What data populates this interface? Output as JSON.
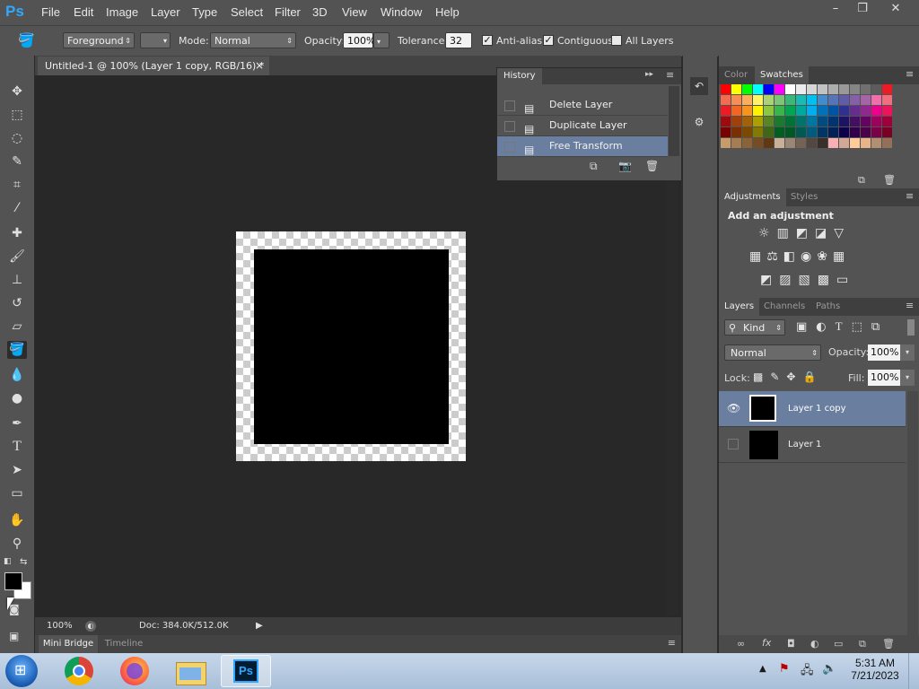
{
  "app": {
    "logo": "Ps"
  },
  "menu": [
    "File",
    "Edit",
    "Image",
    "Layer",
    "Type",
    "Select",
    "Filter",
    "3D",
    "View",
    "Window",
    "Help"
  ],
  "window_controls": {
    "minimize": "–",
    "restore": "❐",
    "close": "✕"
  },
  "options": {
    "fill_source": "Foreground",
    "mode_label": "Mode:",
    "mode_value": "Normal",
    "opacity_label": "Opacity:",
    "opacity_value": "100%",
    "tolerance_label": "Tolerance:",
    "tolerance_value": "32",
    "antialias_label": "Anti-alias",
    "antialias_checked": true,
    "contiguous_label": "Contiguous",
    "contiguous_checked": true,
    "alllayers_label": "All Layers",
    "alllayers_checked": false
  },
  "document": {
    "tab_title": "Untitled-1 @ 100% (Layer 1 copy, RGB/16) *",
    "close_glyph": "×",
    "zoom": "100%",
    "doc_info": "Doc: 384.0K/512.0K"
  },
  "bottom_tabs": [
    "Mini Bridge",
    "Timeline"
  ],
  "history": {
    "title": "History",
    "items": [
      {
        "label": "Delete Layer",
        "selected": false
      },
      {
        "label": "Duplicate Layer",
        "selected": false
      },
      {
        "label": "Free Transform",
        "selected": true
      }
    ]
  },
  "swatches_panel": {
    "tabs": [
      "Color",
      "Swatches"
    ],
    "active": "Swatches",
    "colors": [
      "#ff0000",
      "#ffff00",
      "#00ff00",
      "#00ffff",
      "#0000ff",
      "#ff00ff",
      "#ffffff",
      "#ebebeb",
      "#d6d6d6",
      "#c2c2c2",
      "#adadad",
      "#999999",
      "#858585",
      "#707070",
      "#5c5c5c",
      "#ed1c24",
      "#f26c4f",
      "#f68e55",
      "#fbaf5c",
      "#fff467",
      "#acd372",
      "#7cc576",
      "#3bb878",
      "#1abbb4",
      "#00bff3",
      "#438ccb",
      "#5574b9",
      "#605ca8",
      "#855fa8",
      "#a763a8",
      "#f06ea9",
      "#f26d7d",
      "#ed1c24",
      "#f26522",
      "#f7941d",
      "#fff200",
      "#8dc63f",
      "#39b54a",
      "#00a651",
      "#00a99d",
      "#00aeef",
      "#0072bc",
      "#0054a6",
      "#2e3192",
      "#662d91",
      "#92278f",
      "#ec008c",
      "#ed145b",
      "#9e0b0f",
      "#a0410d",
      "#a36209",
      "#aba000",
      "#598527",
      "#1a7b30",
      "#007236",
      "#00746b",
      "#0076a3",
      "#004b80",
      "#003471",
      "#1b1464",
      "#440e62",
      "#630460",
      "#9e005d",
      "#9e0039",
      "#790000",
      "#7b2e00",
      "#7d4900",
      "#827b00",
      "#406618",
      "#005e20",
      "#005826",
      "#005952",
      "#005b7f",
      "#003663",
      "#002157",
      "#0d004c",
      "#32004b",
      "#4b0049",
      "#7b0046",
      "#7a0026",
      "#c69c6d",
      "#a67c52",
      "#8c6239",
      "#754c24",
      "#603913",
      "#c7b299",
      "#998675",
      "#736357",
      "#534741",
      "#37302a",
      "#f9aeb4",
      "#d2a897",
      "#ffcc99",
      "#e8b48a",
      "#b09070",
      "#957059"
    ]
  },
  "adjustments_panel": {
    "tabs": [
      "Adjustments",
      "Styles"
    ],
    "active": "Adjustments",
    "heading": "Add an adjustment",
    "icons_row1": [
      "brightness-icon",
      "levels-icon",
      "curves-icon",
      "exposure-icon",
      "vibrance-icon"
    ],
    "icons_row2": [
      "hue-saturation-icon",
      "color-balance-icon",
      "black-white-icon",
      "photo-filter-icon",
      "channel-mixer-icon",
      "color-lookup-icon"
    ],
    "icons_row3": [
      "invert-icon",
      "posterize-icon",
      "threshold-icon",
      "selective-color-icon",
      "gradient-map-icon"
    ]
  },
  "layers_panel": {
    "tabs": [
      "Layers",
      "Channels",
      "Paths"
    ],
    "active": "Layers",
    "kind_label": "Kind",
    "blend_mode": "Normal",
    "opacity_label": "Opacity:",
    "opacity_value": "100%",
    "lock_label": "Lock:",
    "fill_label": "Fill:",
    "fill_value": "100%",
    "layers": [
      {
        "name": "Layer 1 copy",
        "visible": true,
        "selected": true
      },
      {
        "name": "Layer 1",
        "visible": false,
        "selected": false
      }
    ]
  },
  "taskbar": {
    "time": "5:31 AM",
    "date": "7/21/2023",
    "apps": [
      "start-orb",
      "chrome-icon",
      "firefox-icon",
      "explorer-icon",
      "photoshop-icon"
    ]
  }
}
